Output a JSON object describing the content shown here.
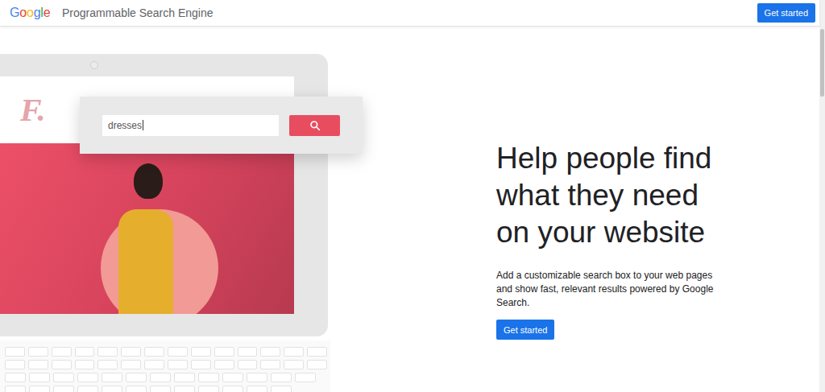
{
  "header": {
    "logo": "Google",
    "title": "Programmable Search Engine",
    "button": "Get started"
  },
  "illustration": {
    "brand_logo": "F.",
    "search_query": "dresses"
  },
  "hero": {
    "heading": "Help people find what they need on your website",
    "description": "Add a customizable search box to your web pages and show fast, relevant results powered by Google Search.",
    "button": "Get started"
  }
}
